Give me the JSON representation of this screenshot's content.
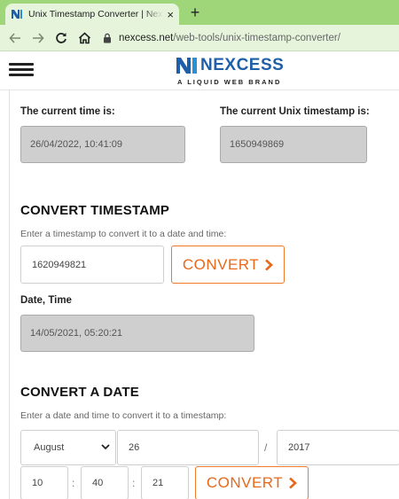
{
  "browser": {
    "tab_title": "Unix Timestamp Converter | Nexcess",
    "tab_close": "×",
    "new_tab": "+",
    "url_host": "nexcess.net",
    "url_path": "/web-tools/unix-timestamp-converter/",
    "icons": [
      "back-arrow-icon",
      "forward-arrow-icon",
      "reload-icon",
      "home-icon",
      "lock-icon"
    ]
  },
  "site": {
    "logo_name": "NEXCESS",
    "logo_sub": "A LIQUID WEB BRAND",
    "brand_color": "#1f5fa8",
    "accent_color": "#e8681a"
  },
  "current": {
    "time_label": "The current time is:",
    "time_value": "26/04/2022, 10:41:09",
    "unix_label": "The current Unix timestamp is:",
    "unix_value": "1650949869"
  },
  "convert_timestamp": {
    "heading": "CONVERT TIMESTAMP",
    "hint": "Enter a timestamp to convert it to a date and time:",
    "input_value": "1620949821",
    "button_label": "CONVERT",
    "result_label": "Date, Time",
    "result_value": "14/05/2021, 05:20:21"
  },
  "convert_date": {
    "heading": "CONVERT A DATE",
    "hint": "Enter a date and time to convert it to a timestamp:",
    "month": "August",
    "day": "26",
    "date_sep": "/",
    "year": "2017",
    "hour": "10",
    "minute": "40",
    "second": "21",
    "time_sep": ":",
    "button_label": "CONVERT"
  }
}
